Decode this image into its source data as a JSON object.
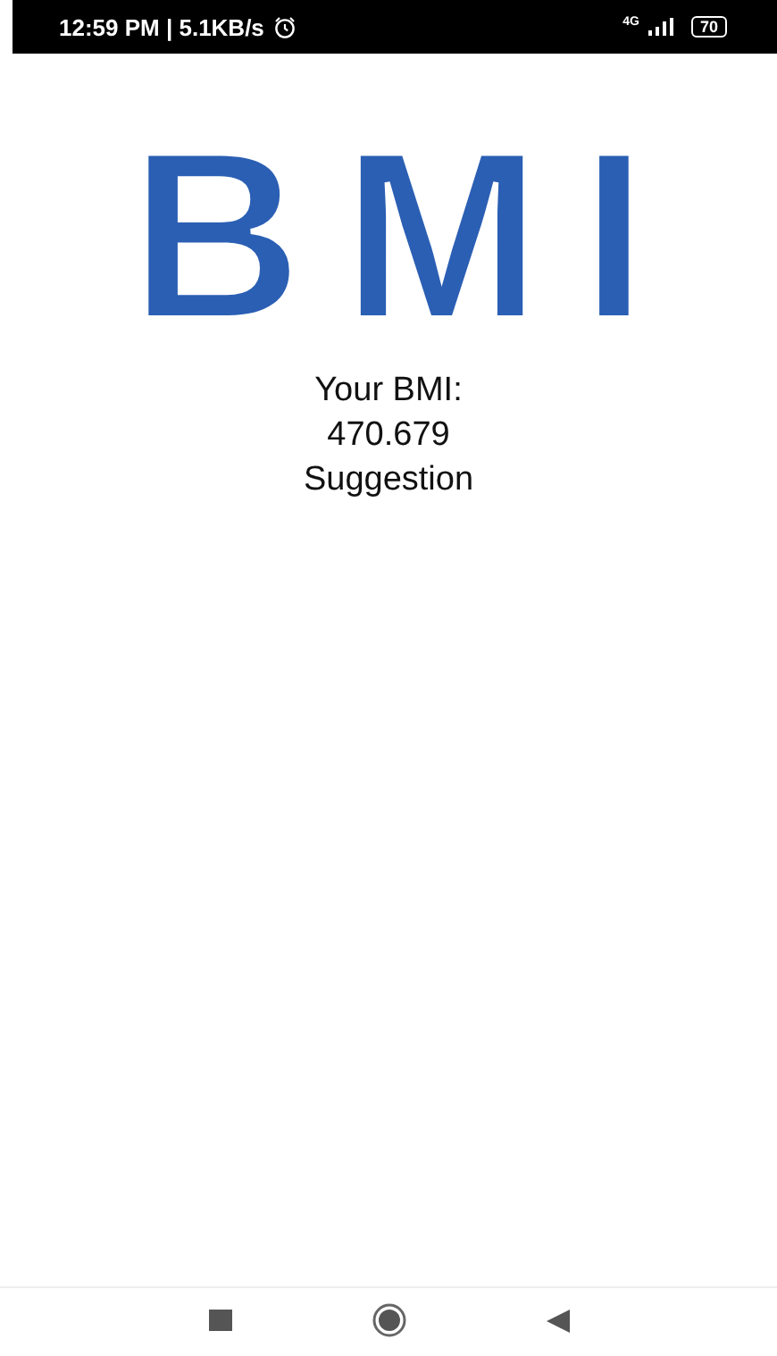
{
  "status_bar": {
    "time": "12:59 PM | 5.1KB/s",
    "network": "4G",
    "battery": "70"
  },
  "logo": "BMI",
  "result": {
    "label": "Your BMI:",
    "value": "470.679",
    "suggestion": "Suggestion"
  }
}
